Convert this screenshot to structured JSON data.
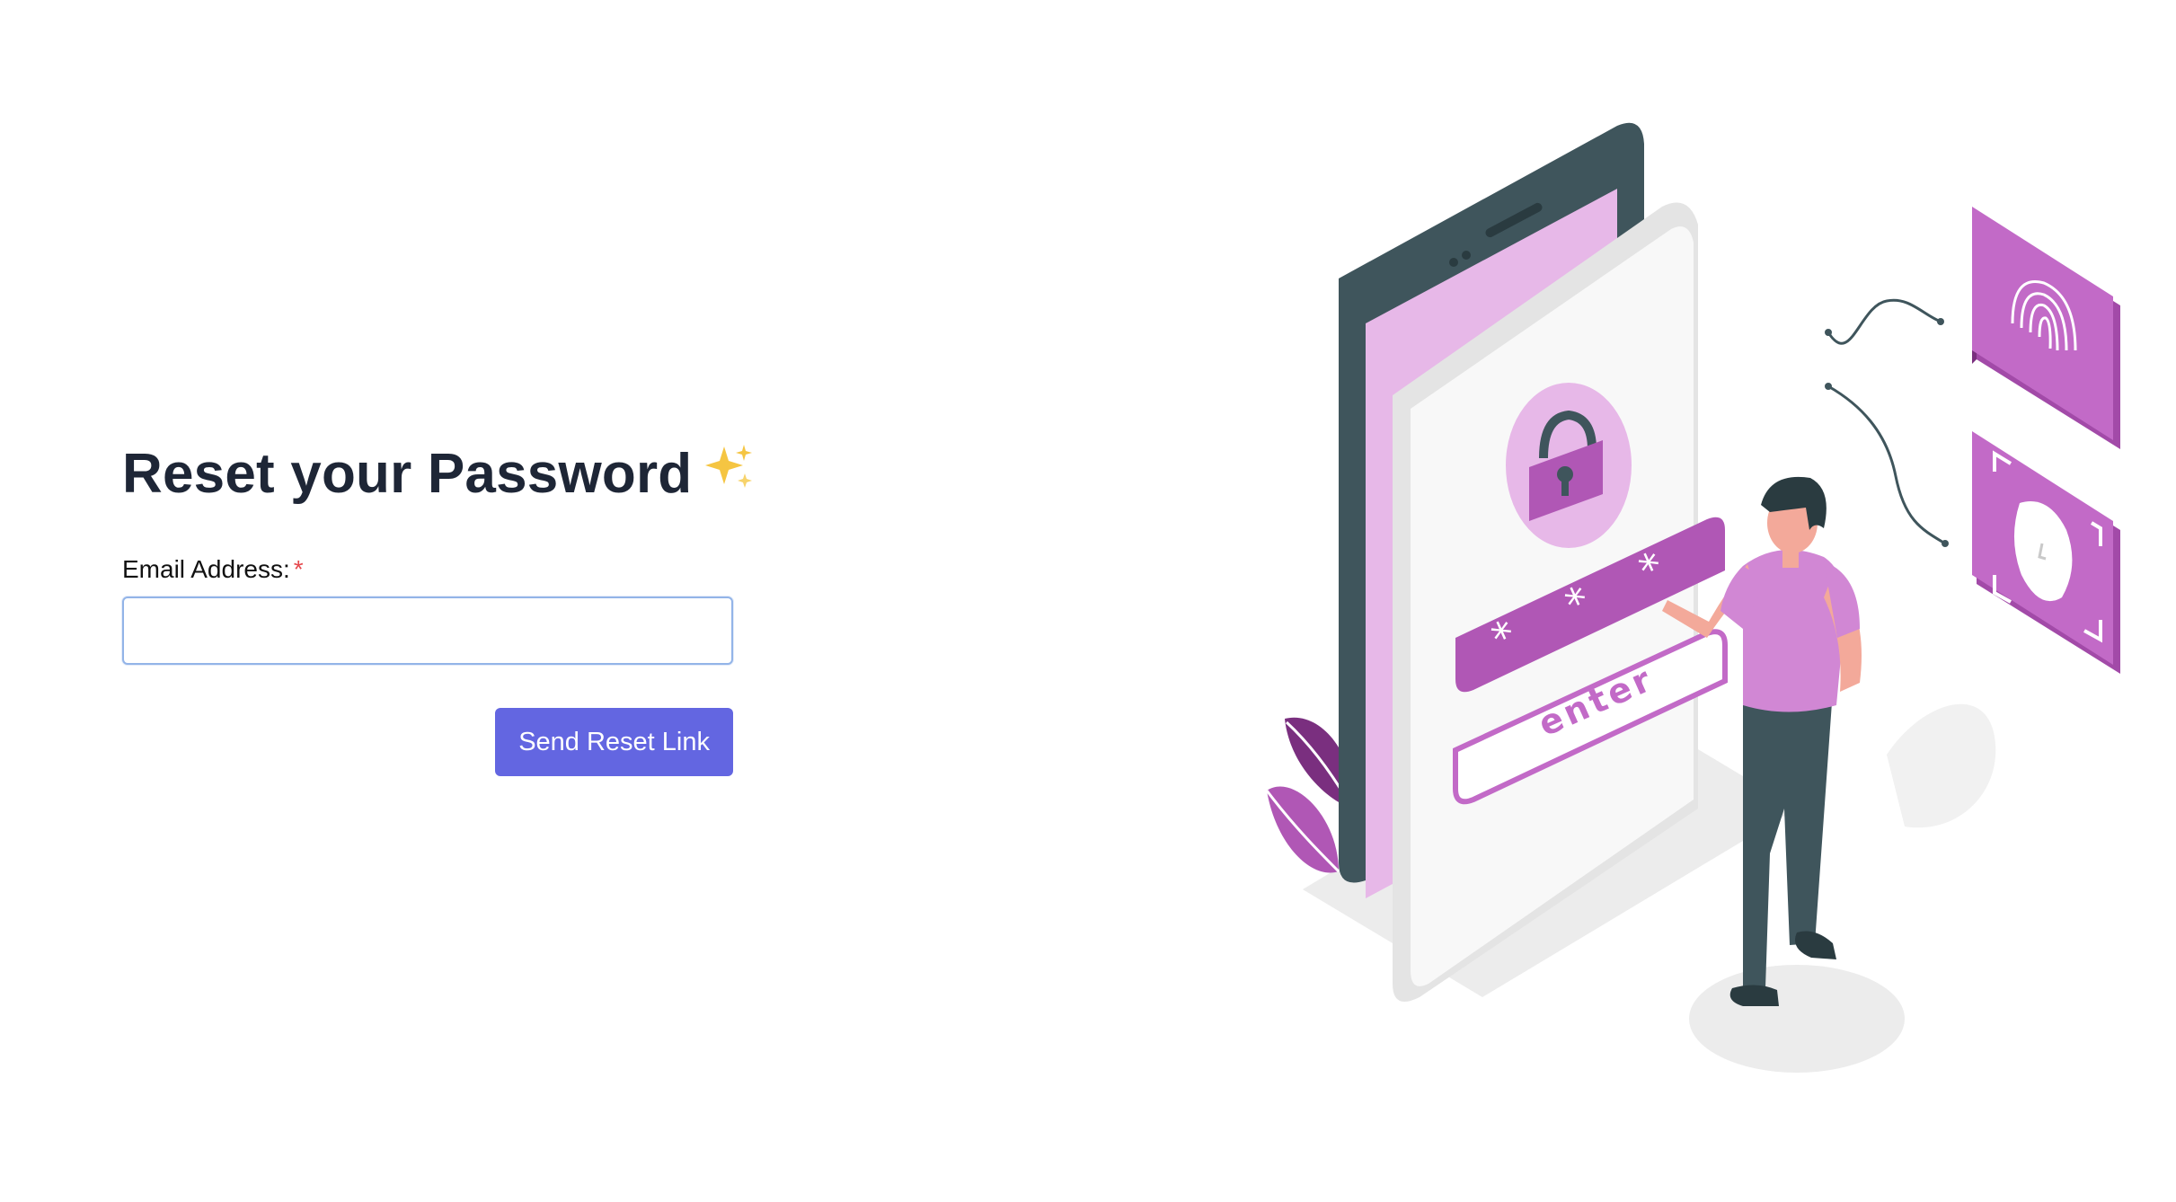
{
  "form": {
    "title": "Reset your Password",
    "title_icon": "sparkles-icon",
    "email_label": "Email Address:",
    "required_marker": "*",
    "email_value": "",
    "email_placeholder": "",
    "submit_label": "Send Reset Link"
  },
  "illustration": {
    "enter_text": "enter",
    "password_mask": [
      "*",
      "*",
      "*"
    ],
    "icons": [
      "lock-icon",
      "fingerprint-icon",
      "face-id-icon"
    ]
  },
  "colors": {
    "primary_button": "#6366e1",
    "accent_purple": "#c26ac7",
    "dark_slate": "#3f555c",
    "title_text": "#1e2636",
    "required": "#e5484d",
    "input_border": "#93b4e8"
  }
}
